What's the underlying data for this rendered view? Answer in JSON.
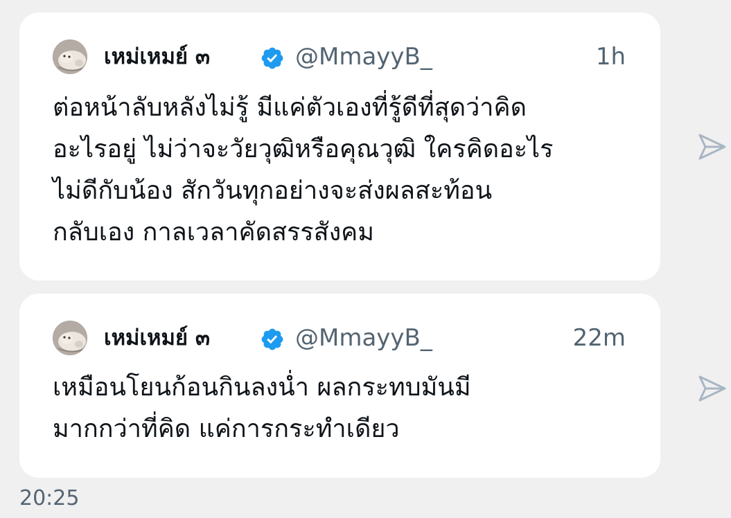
{
  "tweets": [
    {
      "author": "เหม่เหมย์ ๓",
      "handle": "@MmayyB_",
      "time": "1h",
      "lines": [
        "ต่อหน้าลับหลังไม่รู้ มีแค่ตัวเองที่รู้ดีที่สุดว่าคิด",
        "อะไรอยู่ ไม่ว่าจะวัยวุฒิหรือคุณวุฒิ ใครคิดอะไร",
        "ไม่ดีกับน้อง สักวันทุกอย่างจะส่งผลสะท้อน",
        "กลับเอง กาลเวลาคัดสรรสังคม"
      ]
    },
    {
      "author": "เหม่เหมย์ ๓",
      "handle": "@MmayyB_",
      "time": "22m",
      "lines": [
        "เหมือนโยนก้อนกินลงน่ำ ผลกระทบมันมี",
        "มากกว่าที่คิด แค่การกระทำเดียว"
      ]
    }
  ],
  "clock": "20:25",
  "icons": {
    "verified": "verified-badge-icon",
    "share": "share-arrow-icon"
  },
  "colors": {
    "verified": "#1d9bf0",
    "text": "#0f1419",
    "muted": "#536471",
    "background": "#f0f0f1",
    "card": "#ffffff",
    "share_icon": "#a9b6c2"
  }
}
